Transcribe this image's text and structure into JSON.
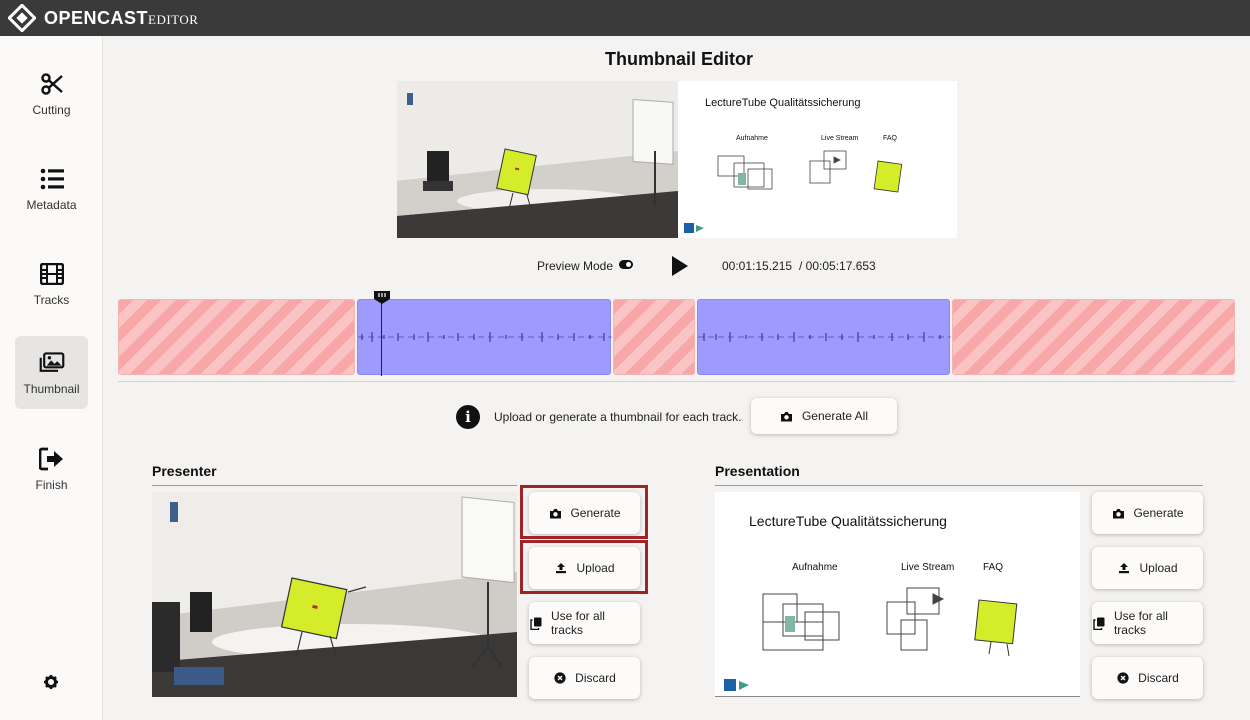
{
  "app": {
    "name": "OPENCAST",
    "sub": "EDITOR"
  },
  "sidebar": {
    "items": [
      {
        "label": "Cutting",
        "icon": "scissors-icon"
      },
      {
        "label": "Metadata",
        "icon": "list-icon"
      },
      {
        "label": "Tracks",
        "icon": "film-icon"
      },
      {
        "label": "Thumbnail",
        "icon": "images-icon",
        "active": true
      },
      {
        "label": "Finish",
        "icon": "sign-out-icon"
      }
    ],
    "settings_icon": "gear-icon"
  },
  "page": {
    "title": "Thumbnail Editor"
  },
  "preview": {
    "slide_title": "LectureTube Qualitätssicherung",
    "slide_labels": [
      "Aufnahme",
      "Live Stream",
      "FAQ"
    ]
  },
  "player": {
    "preview_mode_label": "Preview Mode",
    "current_time": "00:01:15.215",
    "total_time": "/ 00:05:17.653"
  },
  "info": {
    "text": "Upload or generate a thumbnail for each track.",
    "generate_all_label": "Generate All"
  },
  "tracks": [
    {
      "title": "Presenter",
      "buttons": {
        "generate": "Generate",
        "upload": "Upload",
        "use_all": "Use for all tracks",
        "discard": "Discard"
      }
    },
    {
      "title": "Presentation",
      "slide_title": "LectureTube Qualitätssicherung",
      "slide_labels": [
        "Aufnahme",
        "Live Stream",
        "FAQ"
      ],
      "buttons": {
        "generate": "Generate",
        "upload": "Upload",
        "use_all": "Use for all tracks",
        "discard": "Discard"
      }
    }
  ],
  "colors": {
    "header": "#3a3a3a",
    "kept_segment": "#9d9bfe",
    "deleted_segment": "#f7a7a7",
    "highlight": "#a02326",
    "character": "#d4ec2a"
  }
}
